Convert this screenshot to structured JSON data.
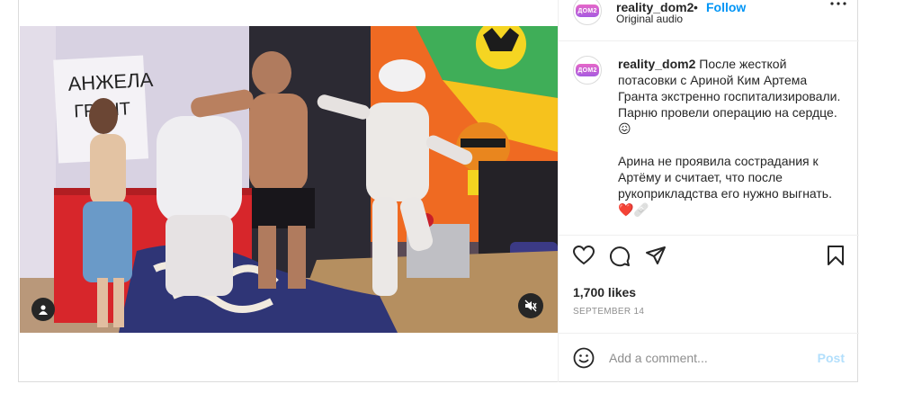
{
  "post": {
    "username": "reality_dom2",
    "separator": "•",
    "follow_label": "Follow",
    "audio_label": "Original audio",
    "avatar_text": "ДОМ2",
    "caption_paragraph_1": "После жесткой потасовки с Ариной Ким Артема Гранта экстренно госпитализировали. Парню провели операцию на сердце. 😖",
    "caption_paragraph_2": "Арина не проявила сострадания к Артёму и считает, что после рукоприкладства его нужно выгнать. ❤️🩹",
    "likes": "1,700 likes",
    "date": "SEPTEMBER 14"
  },
  "media": {
    "sign_text_line1": "АНЖЕЛА",
    "sign_text_line2": "ГРАНТ"
  },
  "comment_box": {
    "placeholder": "Add a comment...",
    "post_label": "Post"
  },
  "icons": {
    "more": "more-horizontal-icon",
    "like": "heart-icon",
    "comment": "comment-bubble-icon",
    "share": "paper-plane-icon",
    "save": "bookmark-icon",
    "emoji": "smiley-icon",
    "mute": "speaker-muted-icon",
    "tag": "user-tag-icon"
  },
  "colors": {
    "link_blue": "#0095f6",
    "post_disabled": "#b2dffc",
    "muted_text": "#8e8e8e",
    "border": "#dbdbdb"
  }
}
